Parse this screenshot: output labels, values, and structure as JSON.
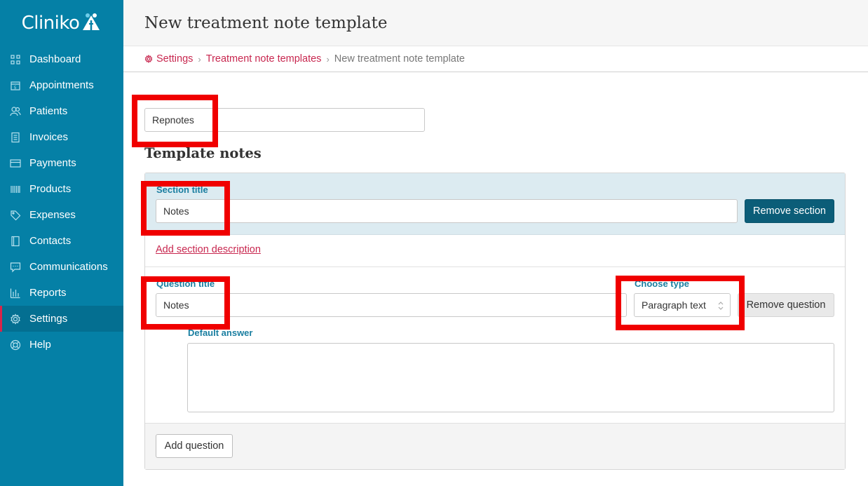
{
  "app": {
    "name": "Cliniko"
  },
  "sidebar": {
    "items": [
      {
        "label": "Dashboard",
        "icon": "grid-icon"
      },
      {
        "label": "Appointments",
        "icon": "calendar-icon"
      },
      {
        "label": "Patients",
        "icon": "people-icon"
      },
      {
        "label": "Invoices",
        "icon": "document-icon"
      },
      {
        "label": "Payments",
        "icon": "card-icon"
      },
      {
        "label": "Products",
        "icon": "barcode-icon"
      },
      {
        "label": "Expenses",
        "icon": "tag-icon"
      },
      {
        "label": "Contacts",
        "icon": "book-icon"
      },
      {
        "label": "Communications",
        "icon": "chat-icon"
      },
      {
        "label": "Reports",
        "icon": "bar-chart-icon"
      },
      {
        "label": "Settings",
        "icon": "gear-icon",
        "active": true
      },
      {
        "label": "Help",
        "icon": "lifebuoy-icon"
      }
    ]
  },
  "header": {
    "title": "New treatment note template"
  },
  "breadcrumb": {
    "settings": "Settings",
    "templates": "Treatment note templates",
    "current": "New treatment note template",
    "separator": "›"
  },
  "form": {
    "name_value": "Repnotes",
    "template_notes_heading": "Template notes",
    "section": {
      "title_label": "Section title",
      "title_value": "Notes",
      "remove_label": "Remove section",
      "add_description_link": "Add section description"
    },
    "question": {
      "title_label": "Question title",
      "title_value": "Notes",
      "type_label": "Choose type",
      "type_value": "Paragraph text",
      "remove_label": "Remove question",
      "default_answer_label": "Default answer",
      "default_answer_value": ""
    },
    "add_question_label": "Add question"
  },
  "colors": {
    "sidebar": "#0580a6",
    "accent_link": "#c8274f",
    "highlight": "#f00000",
    "dark_button": "#0b5d78"
  }
}
